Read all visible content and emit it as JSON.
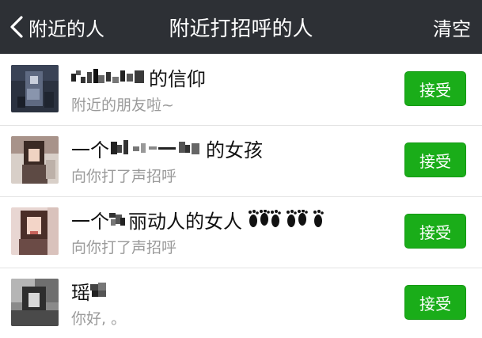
{
  "navbar": {
    "back_label": "附近的人",
    "title": "附近打招呼的人",
    "action_label": "清空"
  },
  "requests": [
    {
      "name_suffix": "的信仰",
      "message": "附近的朋友啦~",
      "accept_label": "接受"
    },
    {
      "name_prefix": "一个",
      "name_suffix": "的女孩",
      "message": "向你打了声招呼",
      "accept_label": "接受"
    },
    {
      "name_prefix": "一个",
      "name_suffix": "丽动人的女人",
      "message": "向你打了声招呼",
      "accept_label": "接受",
      "name_emoji": "footprints-emoji"
    },
    {
      "name_prefix": "瑶",
      "message": "你好, 。",
      "accept_label": "接受"
    }
  ],
  "colors": {
    "navbar_bg": "#2d3035",
    "accept_button": "#1aad19",
    "message_text": "#9a9a9a",
    "page_bg": "#f0eff4"
  }
}
